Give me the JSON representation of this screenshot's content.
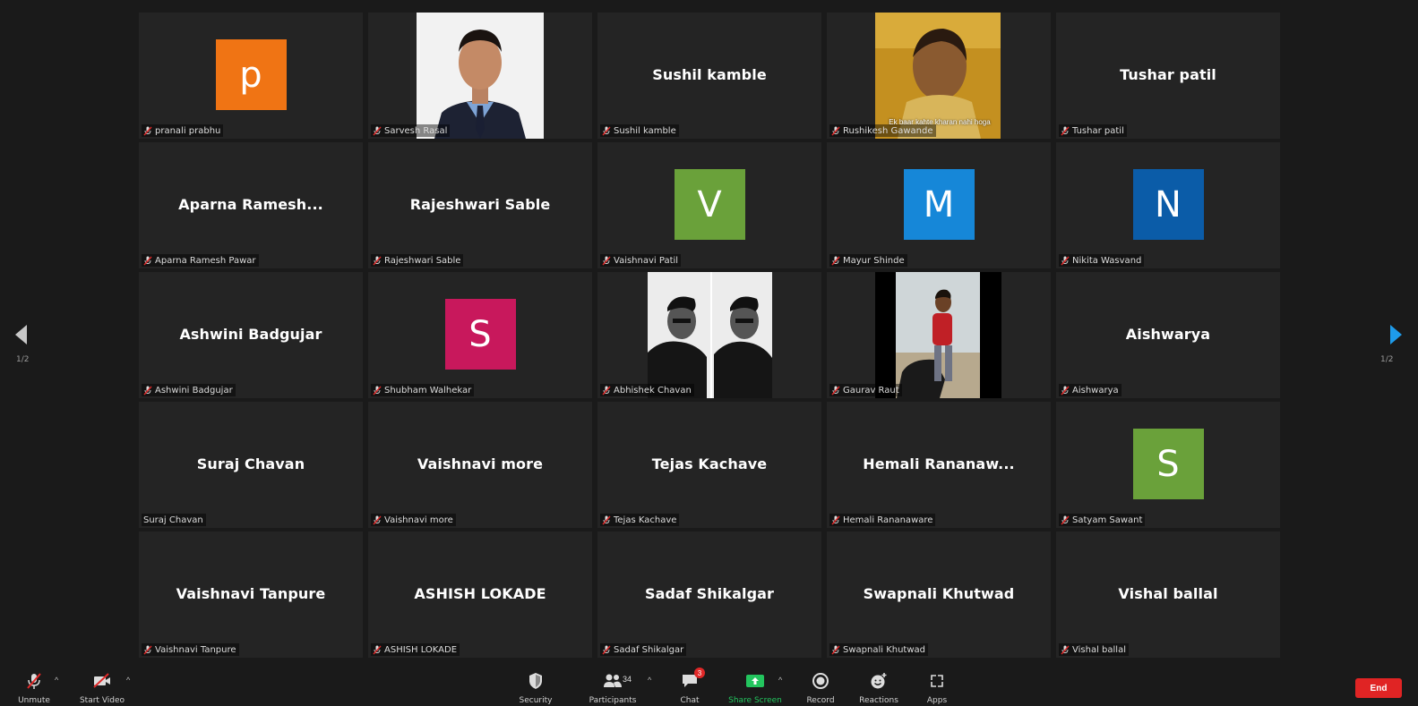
{
  "page_indicator": "1/2",
  "participants": [
    {
      "label": "pranali prabhu",
      "display": "avatar",
      "initial": "p",
      "color": "#f07414",
      "muted": true
    },
    {
      "label": "Sarvesh Rasal",
      "display": "photo",
      "photo": "man-in-suit",
      "muted": true
    },
    {
      "label": "Sushil kamble",
      "display": "name",
      "big_name": "Sushil kamble",
      "muted": true
    },
    {
      "label": "Rushikesh Gawande",
      "display": "photo",
      "photo": "meme-man",
      "caption": "Ek baar kahte kharan nahi hoga",
      "muted": true
    },
    {
      "label": "Tushar patil",
      "display": "name",
      "big_name": "Tushar patil",
      "muted": true
    },
    {
      "label": "Aparna Ramesh Pawar",
      "display": "name",
      "big_name": "Aparna  Ramesh...",
      "muted": true
    },
    {
      "label": "Rajeshwari Sable",
      "display": "name",
      "big_name": "Rajeshwari Sable",
      "muted": true
    },
    {
      "label": "Vaishnavi Patil",
      "display": "avatar",
      "initial": "V",
      "color": "#6aa13a",
      "muted": true
    },
    {
      "label": "Mayur Shinde",
      "display": "avatar",
      "initial": "M",
      "color": "#1687d8",
      "muted": true
    },
    {
      "label": "Nikita Wasvand",
      "display": "avatar",
      "initial": "N",
      "color": "#0b5ca8",
      "muted": true
    },
    {
      "label": "Ashwini Badgujar",
      "display": "name",
      "big_name": "Ashwini Badgujar",
      "muted": true
    },
    {
      "label": "Shubham Walhekar",
      "display": "avatar",
      "initial": "S",
      "color": "#c8185c",
      "muted": true
    },
    {
      "label": "Abhishek Chavan",
      "display": "photo",
      "photo": "bw-portraits",
      "muted": true
    },
    {
      "label": "Gaurav Raut",
      "display": "photo",
      "photo": "man-with-scooter",
      "muted": true
    },
    {
      "label": "Aishwarya",
      "display": "name",
      "big_name": "Aishwarya",
      "muted": true
    },
    {
      "label": "Suraj Chavan",
      "display": "name",
      "big_name": "Suraj Chavan",
      "muted": false
    },
    {
      "label": "Vaishnavi more",
      "display": "name",
      "big_name": "Vaishnavi more",
      "muted": true
    },
    {
      "label": "Tejas Kachave",
      "display": "name",
      "big_name": "Tejas Kachave",
      "muted": true
    },
    {
      "label": "Hemali Rananaware",
      "display": "name",
      "big_name": "Hemali  Rananaw...",
      "muted": true
    },
    {
      "label": "Satyam Sawant",
      "display": "avatar",
      "initial": "S",
      "color": "#6aa13a",
      "muted": true
    },
    {
      "label": "Vaishnavi Tanpure",
      "display": "name",
      "big_name": "Vaishnavi Tanpure",
      "muted": true
    },
    {
      "label": "ASHISH LOKADE",
      "display": "name",
      "big_name": "ASHISH LOKADE",
      "muted": true
    },
    {
      "label": "Sadaf Shikalgar",
      "display": "name",
      "big_name": "Sadaf Shikalgar",
      "muted": true
    },
    {
      "label": "Swapnali Khutwad",
      "display": "name",
      "big_name": "Swapnali Khutwad",
      "muted": true
    },
    {
      "label": "Vishal ballal",
      "display": "name",
      "big_name": "Vishal ballal",
      "muted": true
    }
  ],
  "toolbar": {
    "unmute": "Unmute",
    "start_video": "Start Video",
    "security": "Security",
    "participants": "Participants",
    "participants_count": "34",
    "chat": "Chat",
    "chat_badge": "3",
    "share_screen": "Share Screen",
    "record": "Record",
    "reactions": "Reactions",
    "apps": "Apps",
    "end": "End"
  },
  "colors": {
    "share_green": "#23c55e",
    "end_red": "#e02424",
    "arrow_blue": "#1e9bea"
  }
}
